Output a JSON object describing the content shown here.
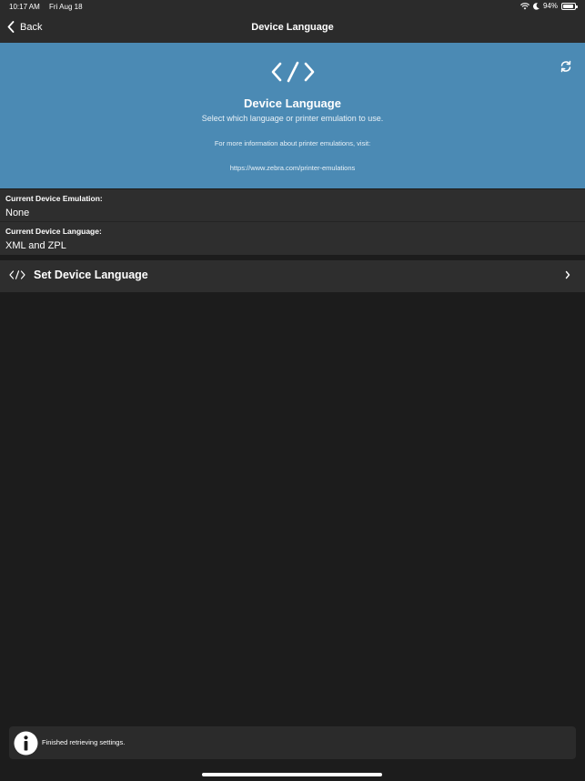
{
  "status_bar": {
    "time": "10:17 AM",
    "date": "Fri Aug 18",
    "battery": "94%",
    "battery_level": 0.94
  },
  "nav": {
    "back_label": "Back",
    "title": "Device Language"
  },
  "hero": {
    "icon": "code-icon",
    "title": "Device Language",
    "subtitle": "Select which language or printer emulation to use.",
    "info": "For more information about printer emulations, visit:",
    "link": "https://www.zebra.com/printer-emulations"
  },
  "rows": {
    "emulation_label": "Current Device Emulation:",
    "emulation_value": "None",
    "language_label": "Current Device Language:",
    "language_value": "XML and ZPL"
  },
  "set_language": {
    "label": "Set Device Language"
  },
  "toast": {
    "message": "Finished retrieving settings."
  },
  "colors": {
    "hero_bg": "#4b8ab4",
    "background": "#1c1c1c",
    "row_bg": "#2e2e2e"
  }
}
